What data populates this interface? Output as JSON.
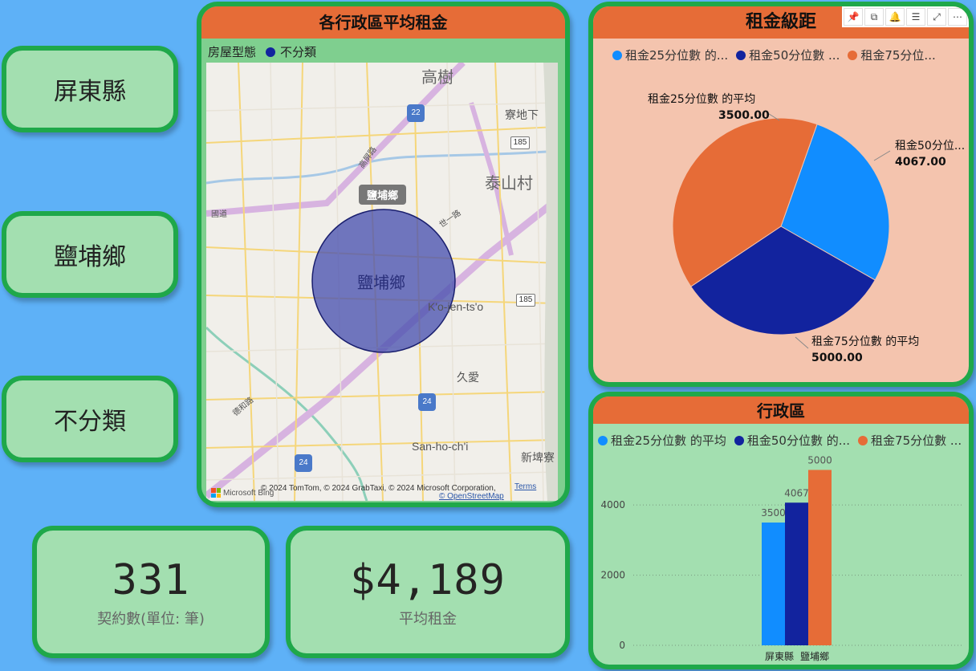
{
  "slicers": [
    {
      "label": "屏東縣"
    },
    {
      "label": "鹽埔鄉"
    },
    {
      "label": "不分類"
    }
  ],
  "kpis": {
    "contracts": {
      "value": "331",
      "label": "契約數(單位: 筆)"
    },
    "avg_rent": {
      "value": "$4,189",
      "label": "平均租金"
    }
  },
  "map": {
    "title": "各行政區平均租金",
    "legend_title": "房屋型態",
    "legend_item": "不分類",
    "legend_color": "#12239e",
    "bubble_tooltip": "鹽埔鄉",
    "bubble_label": "鹽埔鄉",
    "places": {
      "gaoshu": "高樹",
      "liaodixia": "寮地下",
      "taishan": "泰山村",
      "kojen": "K'o-jen-ts'o",
      "jiuai": "久愛",
      "sanhochi": "San-ho-ch'i",
      "xinpi": "新埤寮",
      "road_yongde": "德和路",
      "road_gaoping": "高屏路",
      "road_north": "國道",
      "road_shizhi": "世一路"
    },
    "shields": {
      "r22": "22",
      "r185a": "185",
      "r185b": "185",
      "r24a": "24",
      "r24b": "24"
    },
    "credit": "© 2024 TomTom, © 2024 GrabTaxi, © 2024 Microsoft Corporation,",
    "terms": "Terms",
    "osm": "© OpenStreetMap",
    "bing": "Microsoft Bing"
  },
  "pie": {
    "title": "租金級距",
    "legend": [
      "租金25分位數 的...",
      "租金50分位數 ...",
      "租金75分位..."
    ],
    "labels": [
      {
        "name": "租金25分位數 的平均",
        "value": "3500.00"
      },
      {
        "name": "租金50分位...",
        "value": "4067.00"
      },
      {
        "name": "租金75分位數 的平均",
        "value": "5000.00"
      }
    ]
  },
  "bar": {
    "title": "行政區",
    "legend": [
      "租金25分位數 的平均",
      "租金50分位數 的...",
      "租金75分位數 ..."
    ]
  },
  "colors": {
    "series1": "#118dff",
    "series2": "#12239e",
    "series3": "#e66c37",
    "card_border": "#1fa84a",
    "card_bg": "#a3dfb0",
    "title_bg": "#e66c37",
    "page_bg": "#5eb1f7"
  },
  "chart_data": [
    {
      "type": "pie",
      "title": "租金級距",
      "categories": [
        "租金25分位數 的平均",
        "租金50分位數 的平均",
        "租金75分位數 的平均"
      ],
      "values": [
        3500,
        4067,
        5000
      ],
      "legend": "top"
    },
    {
      "type": "bar",
      "title": "行政區",
      "categories": [
        "屏東縣",
        "鹽埔鄉"
      ],
      "series": [
        {
          "name": "租金25分位數 的平均",
          "values": [
            0,
            3500
          ]
        },
        {
          "name": "租金50分位數 的平均",
          "values": [
            0,
            4067
          ]
        },
        {
          "name": "租金75分位數 的平均",
          "values": [
            0,
            5000
          ]
        }
      ],
      "y_ticks": [
        "0",
        "2000",
        "4000"
      ],
      "data_labels": [
        "3500",
        "4067",
        "5000"
      ],
      "ylim": [
        0,
        5400
      ],
      "grid": true,
      "legend": "top"
    }
  ],
  "toolbar": [
    "pin-icon",
    "copy-icon",
    "bell-icon",
    "filter-icon",
    "expand-icon",
    "more-icon"
  ]
}
